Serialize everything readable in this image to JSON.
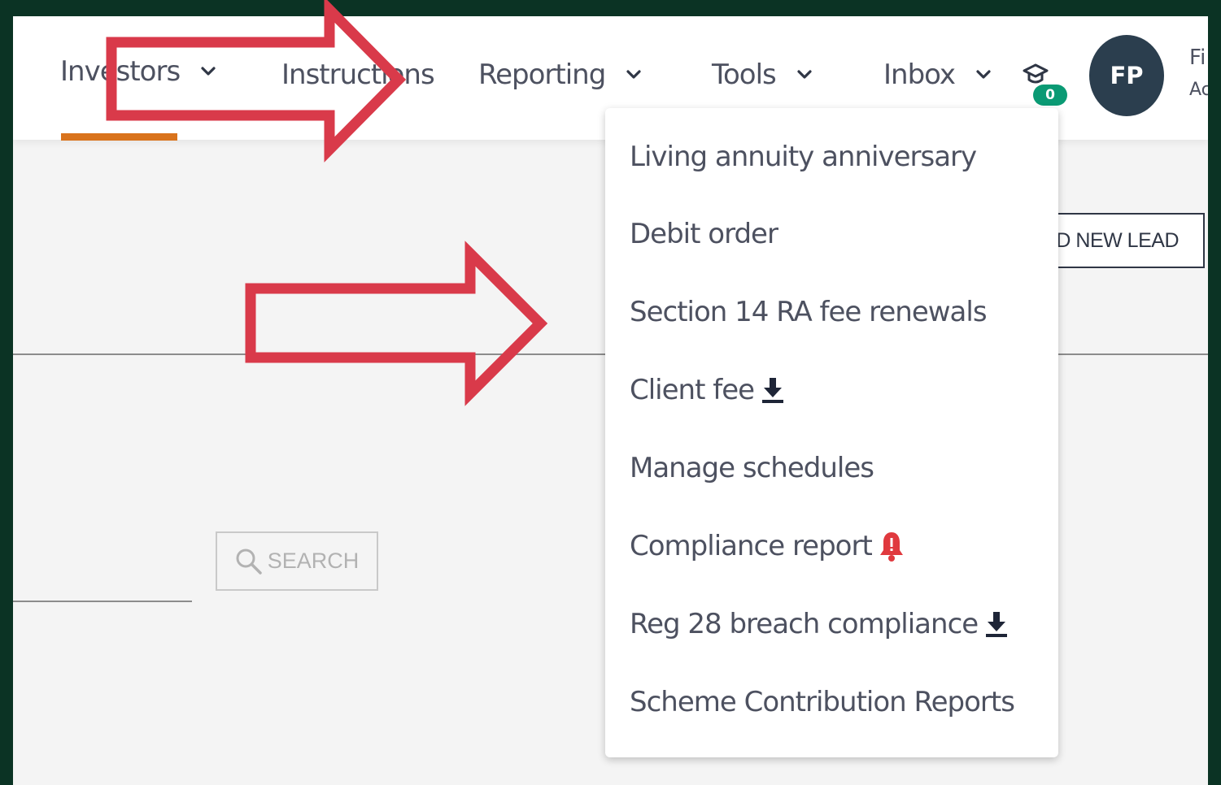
{
  "nav": {
    "items": [
      {
        "label": "Investors",
        "has_chevron": true,
        "active": true
      },
      {
        "label": "Instructions",
        "has_chevron": false
      },
      {
        "label": "Reporting",
        "has_chevron": true
      },
      {
        "label": "Tools",
        "has_chevron": true
      },
      {
        "label": "Inbox",
        "has_chevron": true
      }
    ],
    "learning_badge_count": "0",
    "learning_icon": "graduation-cap-icon",
    "avatar_initials": "FP",
    "user_name_partial": "Fi",
    "user_role_partial": "Ac",
    "active_underline_color": "#d9731c"
  },
  "actions": {
    "add_new_lead_label": "DD NEW LEAD"
  },
  "search": {
    "button_label": "SEARCH",
    "icon": "search-icon"
  },
  "dropdown": {
    "items": [
      {
        "label": "Living annuity anniversary",
        "icon": null
      },
      {
        "label": "Debit order",
        "icon": null
      },
      {
        "label": "Section 14 RA fee renewals",
        "icon": null
      },
      {
        "label": "Client fee",
        "icon": "download-icon"
      },
      {
        "label": "Manage schedules",
        "icon": null
      },
      {
        "label": "Compliance report",
        "icon": "bell-alert-icon"
      },
      {
        "label": "Reg 28 breach compliance",
        "icon": "download-icon"
      },
      {
        "label": "Scheme Contribution Reports",
        "icon": null
      }
    ]
  },
  "annotations": {
    "arrow_color": "#d93a4a",
    "arrow_count": 2
  },
  "colors": {
    "background_frame": "#0b3324",
    "badge_green": "#0a9a74",
    "avatar_bg": "#2b3e4e",
    "alert_red": "#e0393e"
  }
}
